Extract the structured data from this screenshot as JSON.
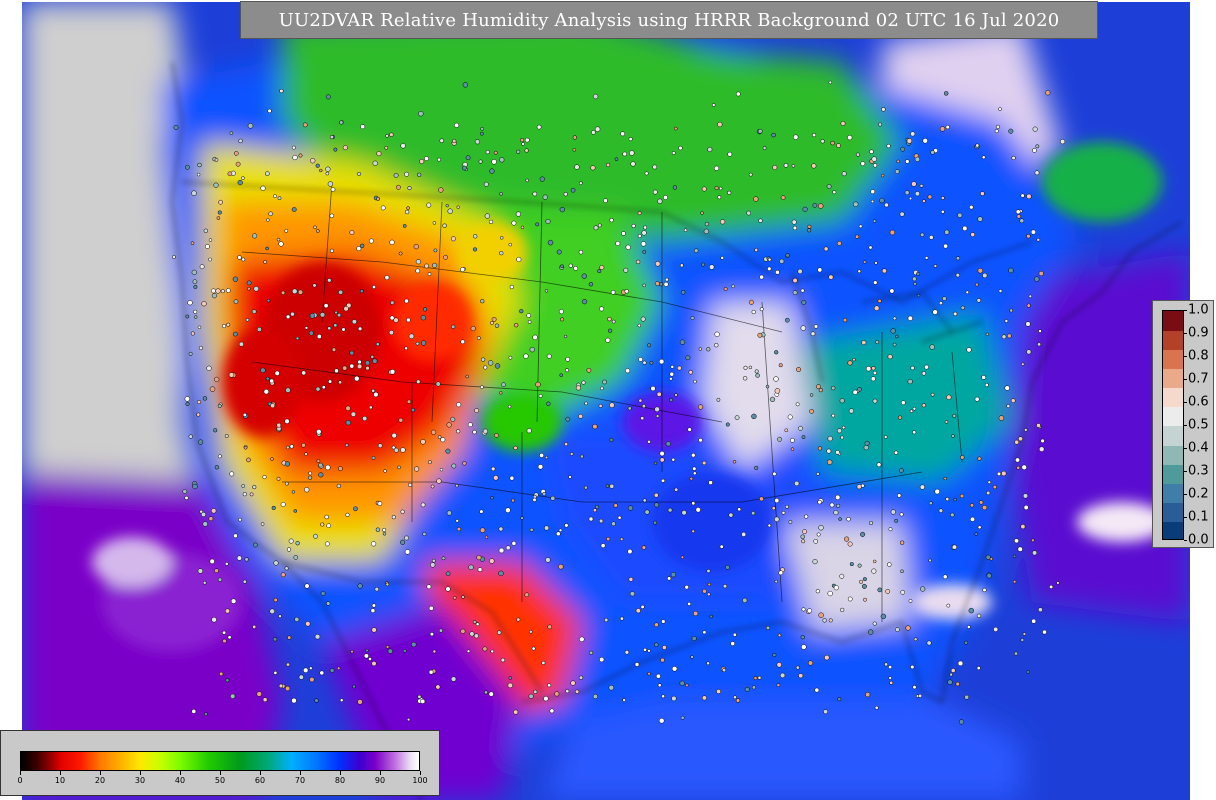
{
  "title": "UU2DVAR Relative Humidity Analysis using HRRR Background 02 UTC 16 Jul 2020",
  "rh_colorbar": {
    "tick_labels": [
      "0",
      "10",
      "20",
      "30",
      "40",
      "50",
      "60",
      "70",
      "80",
      "90",
      "100"
    ],
    "min": 0,
    "max": 100
  },
  "ratio_colorbar": {
    "tick_labels": [
      "1.0",
      "0.9",
      "0.8",
      "0.7",
      "0.6",
      "0.5",
      "0.4",
      "0.3",
      "0.2",
      "0.1",
      "0.0"
    ],
    "colors_low_to_high": [
      "#0b3c7a",
      "#2a5d97",
      "#3f7ea8",
      "#4f9b9b",
      "#8fb8b4",
      "#c5d3d2",
      "#ececec",
      "#f4d9cc",
      "#eaaa8a",
      "#d9744f",
      "#b3412a",
      "#7a0d14"
    ]
  },
  "colors": {
    "ocean": "#1d3fd8",
    "outside_domain": "#cfcfcf",
    "very_dry": "#e60000",
    "dry": "#ff9a00",
    "mid_dry": "#ffe000",
    "moderate": "#33cc00",
    "moist": "#00a878",
    "humid": "#0c52ff",
    "very_humid": "#6a00d0",
    "saturated": "#e6e1ef",
    "panel_background": "#c9c9c9",
    "title_background": "#8c8c8c"
  }
}
